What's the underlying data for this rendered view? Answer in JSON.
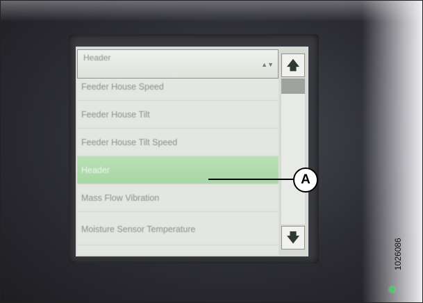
{
  "dropdown": {
    "selected": "Header"
  },
  "list": {
    "items": [
      {
        "label": "Feeder House Speed",
        "selected": false
      },
      {
        "label": "Feeder House Tilt",
        "selected": false
      },
      {
        "label": "Feeder House Tilt Speed",
        "selected": false
      },
      {
        "label": "Header",
        "selected": true
      },
      {
        "label": "Mass Flow Vibration",
        "selected": false
      },
      {
        "label": "Moisture Sensor Temperature",
        "selected": false
      }
    ]
  },
  "scroll": {
    "up_icon": "arrow-up-icon",
    "down_icon": "arrow-down-icon",
    "up_glyph": "🡅",
    "down_glyph": "🡇"
  },
  "callout": {
    "label": "A"
  },
  "figure": {
    "id": "1026086"
  },
  "colors": {
    "selection": "#a7d7a3",
    "status_led": "#3cd25a"
  }
}
